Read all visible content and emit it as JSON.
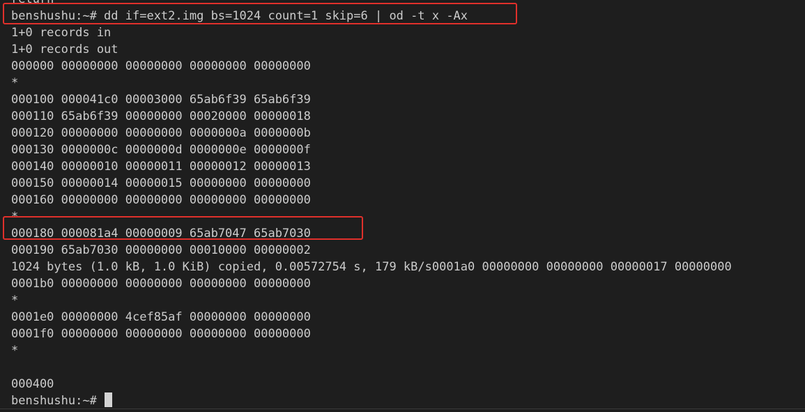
{
  "terminal": {
    "lines": [
      "return",
      "benshushu:~# dd if=ext2.img bs=1024 count=1 skip=6 | od -t x -Ax",
      "1+0 records in",
      "1+0 records out",
      "000000 00000000 00000000 00000000 00000000",
      "*",
      "000100 000041c0 00003000 65ab6f39 65ab6f39",
      "000110 65ab6f39 00000000 00020000 00000018",
      "000120 00000000 00000000 0000000a 0000000b",
      "000130 0000000c 0000000d 0000000e 0000000f",
      "000140 00000010 00000011 00000012 00000013",
      "000150 00000014 00000015 00000000 00000000",
      "000160 00000000 00000000 00000000 00000000",
      "*",
      "000180 000081a4 00000009 65ab7047 65ab7030",
      "000190 65ab7030 00000000 00010000 00000002",
      "1024 bytes (1.0 kB, 1.0 KiB) copied, 0.00572754 s, 179 kB/s0001a0 00000000 00000000 00000017 00000000",
      "0001b0 00000000 00000000 00000000 00000000",
      "*",
      "0001e0 00000000 4cef85af 00000000 00000000",
      "0001f0 00000000 00000000 00000000 00000000",
      "*",
      "",
      "000400"
    ],
    "prompt": "benshushu:~# "
  },
  "colors": {
    "background": "#1e1e1e",
    "text": "#cccccc",
    "highlight_box": "#e0302b"
  }
}
